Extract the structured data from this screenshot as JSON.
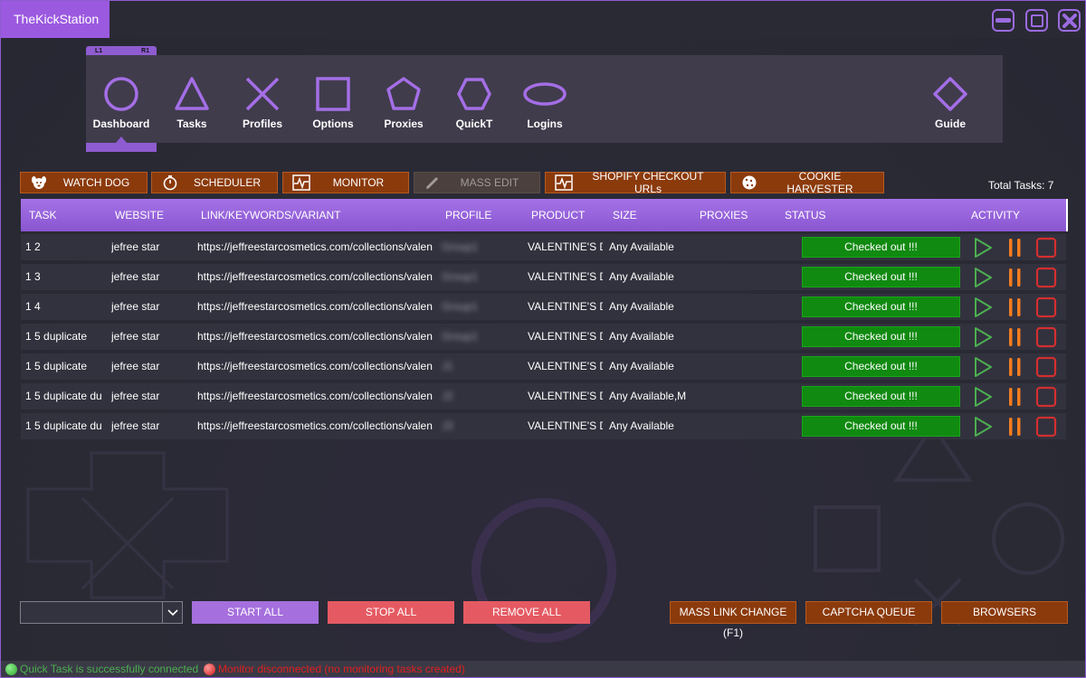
{
  "app": {
    "title": "TheKickStation"
  },
  "nav": {
    "shoulder_left": "L1",
    "shoulder_right": "R1",
    "items": [
      {
        "label": "Dashboard",
        "icon": "circle-icon"
      },
      {
        "label": "Tasks",
        "icon": "triangle-icon"
      },
      {
        "label": "Profiles",
        "icon": "cross-icon"
      },
      {
        "label": "Options",
        "icon": "square-icon"
      },
      {
        "label": "Proxies",
        "icon": "pentagon-icon"
      },
      {
        "label": "QuickT",
        "icon": "hexagon-icon"
      },
      {
        "label": "Logins",
        "icon": "ellipse-icon"
      },
      {
        "label": "Guide",
        "icon": "diamond-icon"
      }
    ],
    "active": "Dashboard"
  },
  "toolbar": {
    "watchdog": "WATCH DOG",
    "scheduler": "SCHEDULER",
    "monitor": "MONITOR",
    "mass_edit": "MASS EDIT",
    "shopify": "SHOPIFY CHECKOUT URLs",
    "cookie": "COOKIE HARVESTER",
    "total_tasks": "Total Tasks: 7"
  },
  "table": {
    "headers": {
      "task": "TASK",
      "website": "WEBSITE",
      "link": "LINK/KEYWORDS/VARIANT",
      "profile": "PROFILE",
      "product": "PRODUCT",
      "size": "SIZE",
      "proxies": "PROXIES",
      "status": "STATUS",
      "activity": "ACTIVITY"
    },
    "rows": [
      {
        "task": "1 2",
        "website": "jefree star",
        "link": "https://jeffreestarcosmetics.com/collections/valen",
        "profile": "Group1",
        "product": "VALENTINE'S D",
        "size": "Any Available",
        "proxies": "",
        "status": "Checked out !!!"
      },
      {
        "task": "1 3",
        "website": "jefree star",
        "link": "https://jeffreestarcosmetics.com/collections/valen",
        "profile": "Group1",
        "product": "VALENTINE'S D",
        "size": "Any Available",
        "proxies": "",
        "status": "Checked out !!!"
      },
      {
        "task": "1 4",
        "website": "jefree star",
        "link": "https://jeffreestarcosmetics.com/collections/valen",
        "profile": "Group1",
        "product": "VALENTINE'S D",
        "size": "Any Available",
        "proxies": "",
        "status": "Checked out !!!"
      },
      {
        "task": "1 5 duplicate",
        "website": "jefree star",
        "link": "https://jeffreestarcosmetics.com/collections/valen",
        "profile": "Group1",
        "product": "VALENTINE'S D",
        "size": "Any Available",
        "proxies": "",
        "status": "Checked out !!!"
      },
      {
        "task": "1 5 duplicate",
        "website": "jefree star",
        "link": "https://jeffreestarcosmetics.com/collections/valen",
        "profile": "J1",
        "product": "VALENTINE'S D",
        "size": "Any Available",
        "proxies": "",
        "status": "Checked out !!!"
      },
      {
        "task": "1 5 duplicate du",
        "website": "jefree star",
        "link": "https://jeffreestarcosmetics.com/collections/valen",
        "profile": "J2",
        "product": "VALENTINE'S D",
        "size": "Any Available,M",
        "proxies": "",
        "status": "Checked out !!!"
      },
      {
        "task": "1 5 duplicate du",
        "website": "jefree star",
        "link": "https://jeffreestarcosmetics.com/collections/valen",
        "profile": "J3",
        "product": "VALENTINE'S D",
        "size": "Any Available",
        "proxies": "",
        "status": "Checked out !!!"
      }
    ]
  },
  "bottom": {
    "combo_value": "",
    "start_all": "START ALL",
    "stop_all": "STOP ALL",
    "remove_all": "REMOVE ALL",
    "mass_link": "MASS LINK CHANGE (F1)",
    "captcha_queue": "CAPTCHA QUEUE",
    "browsers": "BROWSERS"
  },
  "statusbar": {
    "quicktask": "Quick Task is successfully connected",
    "monitor": "Monitor disconnected (no monitoring tasks created)"
  },
  "colors": {
    "accent": "#9b59e0",
    "brown_button": "#8b3a0c",
    "status_green": "#108a10",
    "danger": "#e55a62",
    "play": "#4caf50",
    "pause": "#f57c1f",
    "stop": "#d32f2f"
  }
}
